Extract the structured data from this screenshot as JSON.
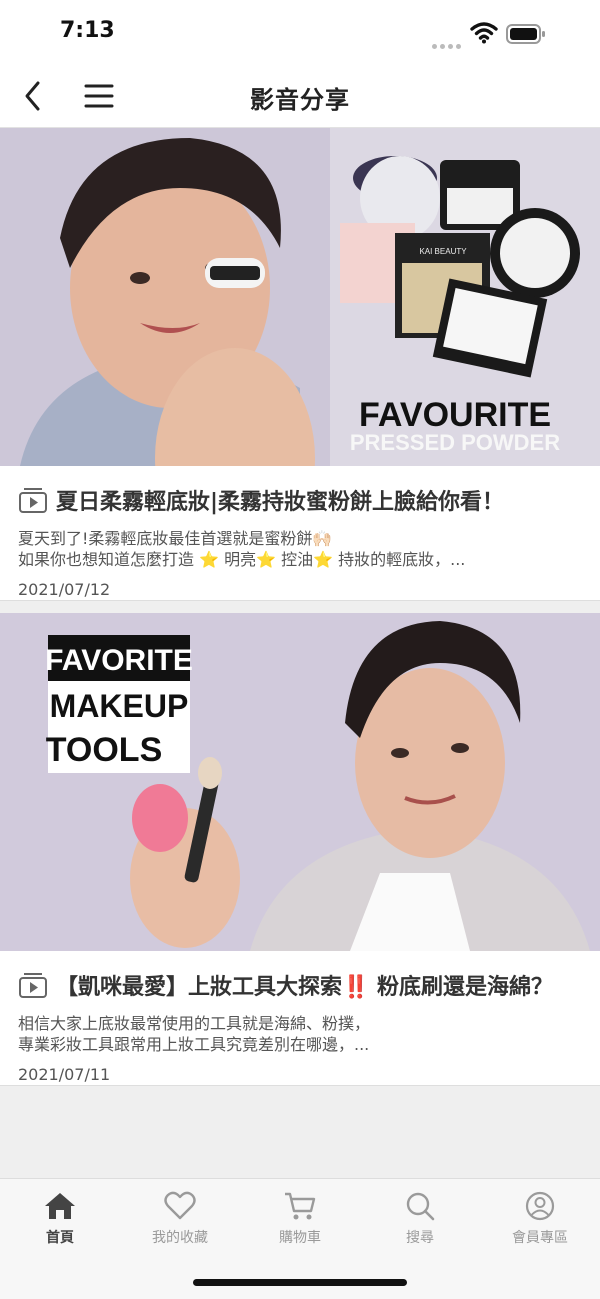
{
  "status_bar": {
    "time": "7:13"
  },
  "header": {
    "title": "影音分享"
  },
  "videos": [
    {
      "title": "夏日柔霧輕底妝|柔霧持妝蜜粉餅上臉給你看！",
      "desc_line1": "夏天到了!柔霧輕底妝最佳首選就是蜜粉餅🙌🏻",
      "desc_line2": "如果你也想知道怎麼打造 ⭐️  明亮⭐️  控油⭐️  持妝的輕底妝，...",
      "date": "2021/07/12",
      "thumb_text_1": "FAVOURITE",
      "thumb_text_2": "PRESSED POWDER",
      "thumb_brand": "KAI BEAUTY"
    },
    {
      "title": "【凱咪最愛】上妝工具大探索‼️ 粉底刷還是海綿？",
      "desc_line1": "相信大家上底妝最常使用的工具就是海綿、粉撲，",
      "desc_line2": "專業彩妝工具跟常用上妝工具究竟差別在哪邊，...",
      "date": "2021/07/11",
      "thumb_text_1": "FAVORITE",
      "thumb_text_2": "MAKEUP",
      "thumb_text_3": "TOOLS"
    }
  ],
  "tabbar": [
    {
      "label": "首頁",
      "icon": "home-icon",
      "active": true
    },
    {
      "label": "我的收藏",
      "icon": "heart-icon",
      "active": false
    },
    {
      "label": "購物車",
      "icon": "cart-icon",
      "active": false
    },
    {
      "label": "搜尋",
      "icon": "search-icon",
      "active": false
    },
    {
      "label": "會員專區",
      "icon": "user-icon",
      "active": false
    }
  ],
  "colors": {
    "accent": "#444444",
    "inactive": "#9a9a9a",
    "thumb_bg": "#cdc7d8"
  }
}
